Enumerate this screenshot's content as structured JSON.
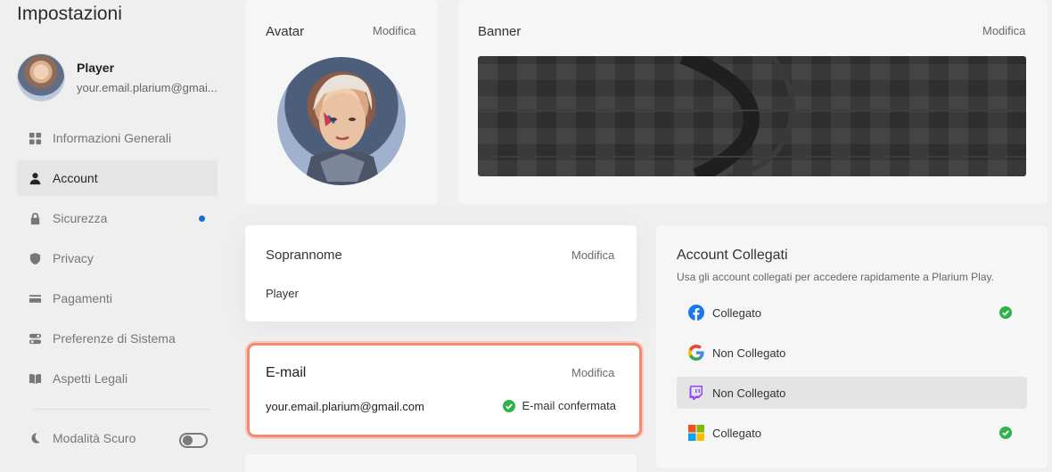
{
  "sidebar": {
    "title": "Impostazioni",
    "profile": {
      "name": "Player",
      "email": "your.email.plarium@gmai..."
    },
    "items": [
      {
        "label": "Informazioni Generali",
        "icon": "grid-icon"
      },
      {
        "label": "Account",
        "icon": "user-icon",
        "active": true
      },
      {
        "label": "Sicurezza",
        "icon": "lock-icon",
        "badge": true
      },
      {
        "label": "Privacy",
        "icon": "shield-icon"
      },
      {
        "label": "Pagamenti",
        "icon": "card-icon"
      },
      {
        "label": "Preferenze di Sistema",
        "icon": "toggle-settings-icon"
      },
      {
        "label": "Aspetti Legali",
        "icon": "book-icon"
      }
    ],
    "dark_mode_label": "Modalità Scuro"
  },
  "avatar_card": {
    "title": "Avatar",
    "edit": "Modifica"
  },
  "banner_card": {
    "title": "Banner",
    "edit": "Modifica"
  },
  "nickname_card": {
    "title": "Soprannome",
    "edit": "Modifica",
    "value": "Player"
  },
  "email_card": {
    "title": "E-mail",
    "edit": "Modifica",
    "value": "your.email.plarium@gmail.com",
    "status": "E-mail confermata"
  },
  "linked_card": {
    "title": "Account Collegati",
    "description": "Usa gli account collegati per accedere rapidamente a Plarium Play.",
    "accounts": [
      {
        "service": "facebook",
        "status": "Collegato",
        "linked": true
      },
      {
        "service": "google",
        "status": "Non Collegato",
        "linked": false
      },
      {
        "service": "twitch",
        "status": "Non Collegato",
        "linked": false
      },
      {
        "service": "microsoft",
        "status": "Collegato",
        "linked": true
      }
    ]
  },
  "colors": {
    "accent": "#1470d6",
    "success": "#2fb24b",
    "highlight": "#f58a6a"
  }
}
